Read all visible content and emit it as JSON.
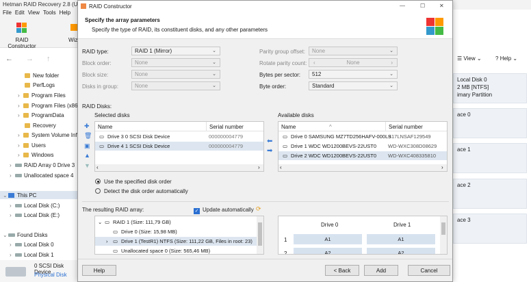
{
  "app": {
    "title": "Hetman RAID Recovery 2.8 (Un",
    "menu": [
      "File",
      "Edit",
      "View",
      "Tools",
      "Help"
    ],
    "ribbon": {
      "raid_constructor": "RAID Constructor",
      "wizard": "Wiz"
    },
    "right_header": {
      "view": "View",
      "help": "Help"
    },
    "tree": [
      {
        "label": "New folder"
      },
      {
        "label": "PerfLogs"
      },
      {
        "label": "Program Files"
      },
      {
        "label": "Program Files (x86)"
      },
      {
        "label": "ProgramData"
      },
      {
        "label": "Recovery"
      },
      {
        "label": "System Volume Infor"
      },
      {
        "label": "Users"
      },
      {
        "label": "Windows"
      },
      {
        "label": "RAID Array 0 Drive 3"
      },
      {
        "label": "Unallocated space 4"
      },
      {
        "label": "This PC"
      },
      {
        "label": "Local Disk (C:)"
      },
      {
        "label": "Local Disk (E:)"
      },
      {
        "label": "Found Disks"
      },
      {
        "label": "Local Disk 0"
      },
      {
        "label": "Local Disk 1"
      }
    ],
    "right_tiles": [
      {
        "line1": "Local Disk 0",
        "line2": "2 MB [NTFS]",
        "line3": "imary Partition"
      },
      {
        "line1": "ace 0"
      },
      {
        "line1": "ace 1"
      },
      {
        "line1": "ace 2"
      },
      {
        "line1": "ace 3"
      }
    ],
    "bottom": {
      "line1": "0 SCSI Disk Device",
      "line2": "Physical Disk"
    }
  },
  "dialog": {
    "title": "RAID Constructor",
    "heading": "Specify the array parameters",
    "subheading": "Specify the type of RAID, its constituent disks, and any other parameters",
    "fields_left": [
      {
        "label": "RAID type:",
        "value": "RAID 1 (Mirror)",
        "enabled": true
      },
      {
        "label": "Block order:",
        "value": "None",
        "enabled": false
      },
      {
        "label": "Block size:",
        "value": "None",
        "enabled": false
      },
      {
        "label": "Disks in group:",
        "value": "None",
        "enabled": false
      }
    ],
    "fields_right": [
      {
        "label": "Parity group offset:",
        "value": "None",
        "enabled": false
      },
      {
        "label": "Rotate parity count:",
        "value": "None",
        "enabled": false
      },
      {
        "label": "Bytes per sector:",
        "value": "512",
        "enabled": true
      },
      {
        "label": "Byte order:",
        "value": "Standard",
        "enabled": true
      }
    ],
    "raid_disks_label": "RAID Disks:",
    "selected_label": "Selected disks",
    "available_label": "Available disks",
    "col_name": "Name",
    "col_serial": "Serial number",
    "selected_disks": [
      {
        "name": "Drive 3 0 SCSI Disk Device",
        "serial": "000000004779"
      },
      {
        "name": "Drive 4 1 SCSI Disk Device",
        "serial": "000000004779"
      }
    ],
    "available_disks": [
      {
        "name": "Drive 0 SAMSUNG MZ7TD256HAFV-000L9",
        "serial": "S17LNSAF129549"
      },
      {
        "name": "Drive 1 WDC WD1200BEVS-22UST0",
        "serial": "WD-WXC308D08629"
      },
      {
        "name": "Drive 2 WDC WD1200BEVS-22UST0",
        "serial": "WD-WXC408335810"
      }
    ],
    "radio_specified": "Use the specified disk order",
    "radio_auto": "Detect the disk order automatically",
    "result_label": "The resulting RAID array:",
    "update_auto": "Update automatically",
    "result_tree": [
      "RAID 1 (Size: 111,79 GB)",
      "Drive 0 (Size: 15,98 MB)",
      "Drive 1 (TestR1) NTFS (Size: 111,22 GB, Files in root: 23)",
      "Unallocated space 0 (Size: 565,46 MB)"
    ],
    "grid": {
      "cols": [
        "Drive 0",
        "Drive 1"
      ],
      "rows": [
        {
          "n": "1",
          "cells": [
            "A1",
            "A1"
          ]
        },
        {
          "n": "2",
          "cells": [
            "A2",
            "A2"
          ]
        }
      ]
    },
    "buttons": {
      "help": "Help",
      "back": "< Back",
      "add": "Add",
      "cancel": "Cancel"
    },
    "window_controls": {
      "minimize": "—",
      "maximize": "☐",
      "close": "✕"
    }
  }
}
